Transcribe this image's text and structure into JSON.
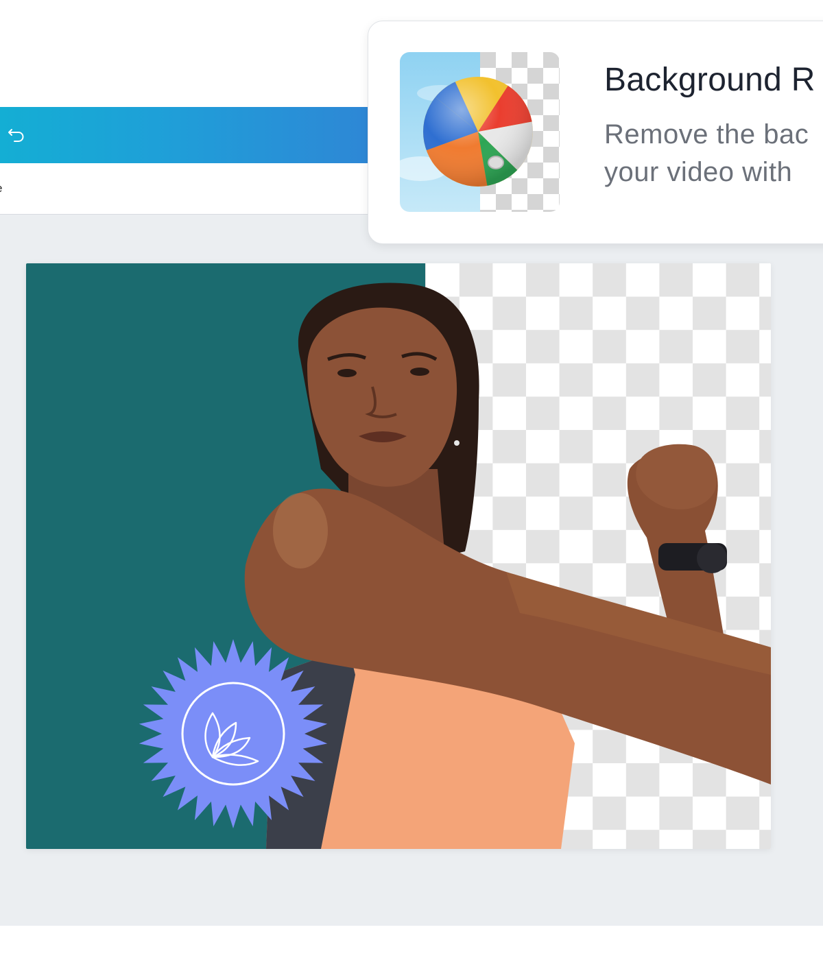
{
  "editor": {
    "subbar_text": "e",
    "undo_icon": "undo-icon"
  },
  "feature_card": {
    "title": "Background R",
    "description_line1": "Remove the bac",
    "description_line2": "your video with",
    "thumbnail_icon": "beach-ball"
  },
  "canvas": {
    "background_color": "#1b6b6f",
    "badge_color": "#7b8ef8",
    "badge_icon": "lotus-icon"
  }
}
